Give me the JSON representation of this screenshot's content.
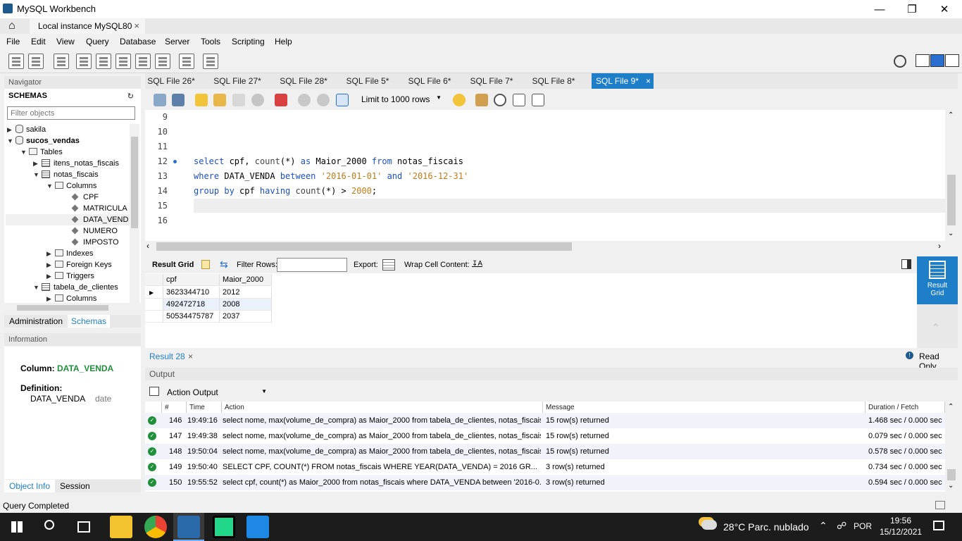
{
  "window": {
    "title": "MySQL Workbench"
  },
  "connection_tab": {
    "label": "Local instance MySQL80"
  },
  "menu": [
    "File",
    "Edit",
    "View",
    "Query",
    "Database",
    "Server",
    "Tools",
    "Scripting",
    "Help"
  ],
  "navigator": {
    "header": "Navigator",
    "schemas_label": "SCHEMAS",
    "filter_placeholder": "Filter objects",
    "tree": [
      {
        "label": "sakila"
      },
      {
        "label": "sucos_vendas"
      },
      {
        "label": "Tables"
      },
      {
        "label": "itens_notas_fiscais"
      },
      {
        "label": "notas_fiscais"
      },
      {
        "label": "Columns"
      },
      {
        "label": "CPF"
      },
      {
        "label": "MATRICULA"
      },
      {
        "label": "DATA_VEND"
      },
      {
        "label": "NUMERO"
      },
      {
        "label": "IMPOSTO"
      },
      {
        "label": "Indexes"
      },
      {
        "label": "Foreign Keys"
      },
      {
        "label": "Triggers"
      },
      {
        "label": "tabela_de_clientes"
      },
      {
        "label": "Columns"
      }
    ],
    "tabs": [
      "Administration",
      "Schemas"
    ]
  },
  "information": {
    "header": "Information",
    "column_label": "Column:",
    "column_value": "DATA_VENDA",
    "definition_label": "Definition:",
    "definition_name": "DATA_VENDA",
    "definition_type": "date",
    "tabs": [
      "Object Info",
      "Session"
    ]
  },
  "sql_tabs": [
    "SQL File 26*",
    "SQL File 27*",
    "SQL File 28*",
    "SQL File 5*",
    "SQL File 6*",
    "SQL File 7*",
    "SQL File 8*",
    "SQL File 9*"
  ],
  "editor_toolbar": {
    "limit": "Limit to 1000 rows"
  },
  "editor": {
    "lines": [
      {
        "n": "9",
        "text": ""
      },
      {
        "n": "10",
        "text": ""
      },
      {
        "n": "11",
        "text": ""
      },
      {
        "n": "12",
        "text": "select cpf, count(*) as Maior_2000 from notas_fiscais"
      },
      {
        "n": "13",
        "text": "where DATA_VENDA between '2016-01-01' and '2016-12-31'"
      },
      {
        "n": "14",
        "text": "group by cpf having count(*) > 2000;"
      },
      {
        "n": "15",
        "text": ""
      },
      {
        "n": "16",
        "text": ""
      }
    ]
  },
  "result_toolbar": {
    "result_grid": "Result Grid",
    "filter_rows": "Filter Rows:",
    "export": "Export:",
    "wrap": "Wrap Cell Content:"
  },
  "result_grid": {
    "columns": [
      "cpf",
      "Maior_2000"
    ],
    "rows": [
      [
        "3623344710",
        "2012"
      ],
      [
        "492472718",
        "2008"
      ],
      [
        "50534475787",
        "2037"
      ]
    ]
  },
  "result_side": {
    "label1": "Result",
    "label2": "Grid"
  },
  "result_tab": {
    "label": "Result 28",
    "read_only": "Read Only"
  },
  "output": {
    "header": "Output",
    "mode": "Action Output",
    "columns": [
      "#",
      "Time",
      "Action",
      "Message",
      "Duration / Fetch"
    ],
    "rows": [
      {
        "num": "146",
        "time": "19:49:16",
        "action": "select nome, max(volume_de_compra) as Maior_2000 from tabela_de_clientes, notas_fiscais ...",
        "message": "15 row(s) returned",
        "duration": "1.468 sec / 0.000 sec"
      },
      {
        "num": "147",
        "time": "19:49:38",
        "action": "select nome, max(volume_de_compra) as Maior_2000 from tabela_de_clientes, notas_fiscais ...",
        "message": "15 row(s) returned",
        "duration": "0.079 sec / 0.000 sec"
      },
      {
        "num": "148",
        "time": "19:50:04",
        "action": "select nome, max(volume_de_compra) as Maior_2000 from tabela_de_clientes, notas_fiscais ...",
        "message": "15 row(s) returned",
        "duration": "0.578 sec / 0.000 sec"
      },
      {
        "num": "149",
        "time": "19:50:40",
        "action": "SELECT CPF, COUNT(*) FROM notas_fiscais   WHERE YEAR(DATA_VENDA) = 2016   GR...",
        "message": "3 row(s) returned",
        "duration": "0.734 sec / 0.000 sec"
      },
      {
        "num": "150",
        "time": "19:55:52",
        "action": "select cpf, count(*) as Maior_2000 from notas_fiscais where DATA_VENDA between '2016-0...",
        "message": "3 row(s) returned",
        "duration": "0.594 sec / 0.000 sec"
      }
    ]
  },
  "status": {
    "text": "Query Completed"
  },
  "taskbar": {
    "weather": "28°C  Parc. nublado",
    "lang": "POR",
    "time": "19:56",
    "date": "15/12/2021"
  },
  "colors": {
    "accent": "#1e7ec8",
    "keyword": "#1c4fc1",
    "string": "#c27a15",
    "ok": "#1f8f3a"
  }
}
